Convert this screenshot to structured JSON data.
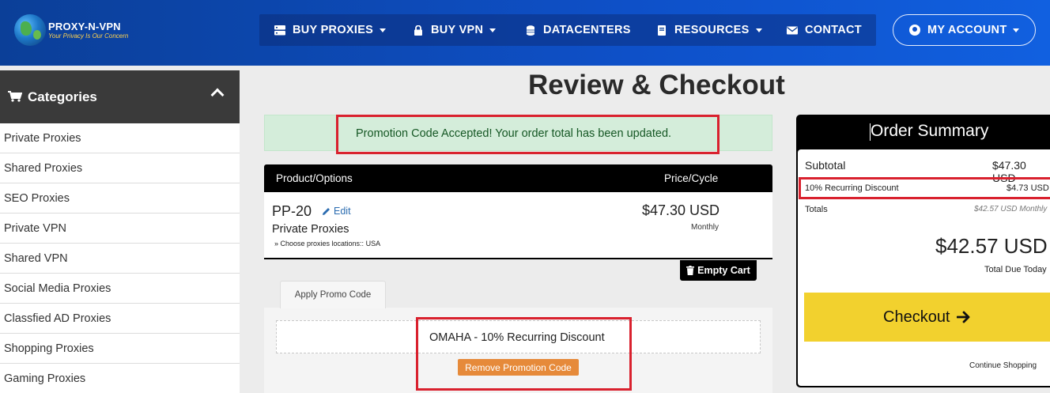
{
  "header": {
    "brand": "PROXY-N-VPN",
    "tagline": "Your Privacy Is Our Concern",
    "nav": [
      {
        "label": "BUY PROXIES",
        "icon": "server-icon",
        "dropdown": true
      },
      {
        "label": "BUY VPN",
        "icon": "lock-icon",
        "dropdown": true
      },
      {
        "label": "DATACENTERS",
        "icon": "database-icon",
        "dropdown": false
      },
      {
        "label": "RESOURCES",
        "icon": "book-icon",
        "dropdown": true
      },
      {
        "label": "CONTACT",
        "icon": "envelope-icon",
        "dropdown": false
      }
    ],
    "account_label": "MY ACCOUNT"
  },
  "sidebar": {
    "title": "Categories",
    "items": [
      "Private Proxies",
      "Shared Proxies",
      "SEO Proxies",
      "Private VPN",
      "Shared VPN",
      "Social Media Proxies",
      "Classfied AD Proxies",
      "Shopping Proxies",
      "Gaming Proxies"
    ]
  },
  "main": {
    "title": "Review & Checkout",
    "alert": "Promotion Code Accepted! Your order total has been updated.",
    "table": {
      "col_product": "Product/Options",
      "col_price": "Price/Cycle",
      "item": {
        "name": "PP-20",
        "edit": "Edit",
        "group": "Private Proxies",
        "option": "» Choose proxies locations:: USA",
        "price": "$47.30 USD",
        "cycle": "Monthly"
      }
    },
    "empty_cart": "Empty Cart",
    "promo": {
      "tab": "Apply Promo Code",
      "applied": "OMAHA - 10% Recurring Discount",
      "remove": "Remove Promotion Code"
    }
  },
  "summary": {
    "title": "Order Summary",
    "subtotal_label": "Subtotal",
    "subtotal_value": "$47.30 USD",
    "discount_label": "10% Recurring Discount",
    "discount_value": "$4.73 USD",
    "totals_label": "Totals",
    "totals_value": "$42.57 USD Monthly",
    "total_due": "$42.57 USD",
    "total_due_label": "Total Due Today",
    "checkout": "Checkout",
    "continue": "Continue Shopping"
  },
  "colors": {
    "header_blue": "#0e50c8",
    "alert_green_bg": "#d4edda",
    "highlight_red": "#d9212e",
    "checkout_yellow": "#f2d12e",
    "remove_orange": "#e68a3a"
  }
}
